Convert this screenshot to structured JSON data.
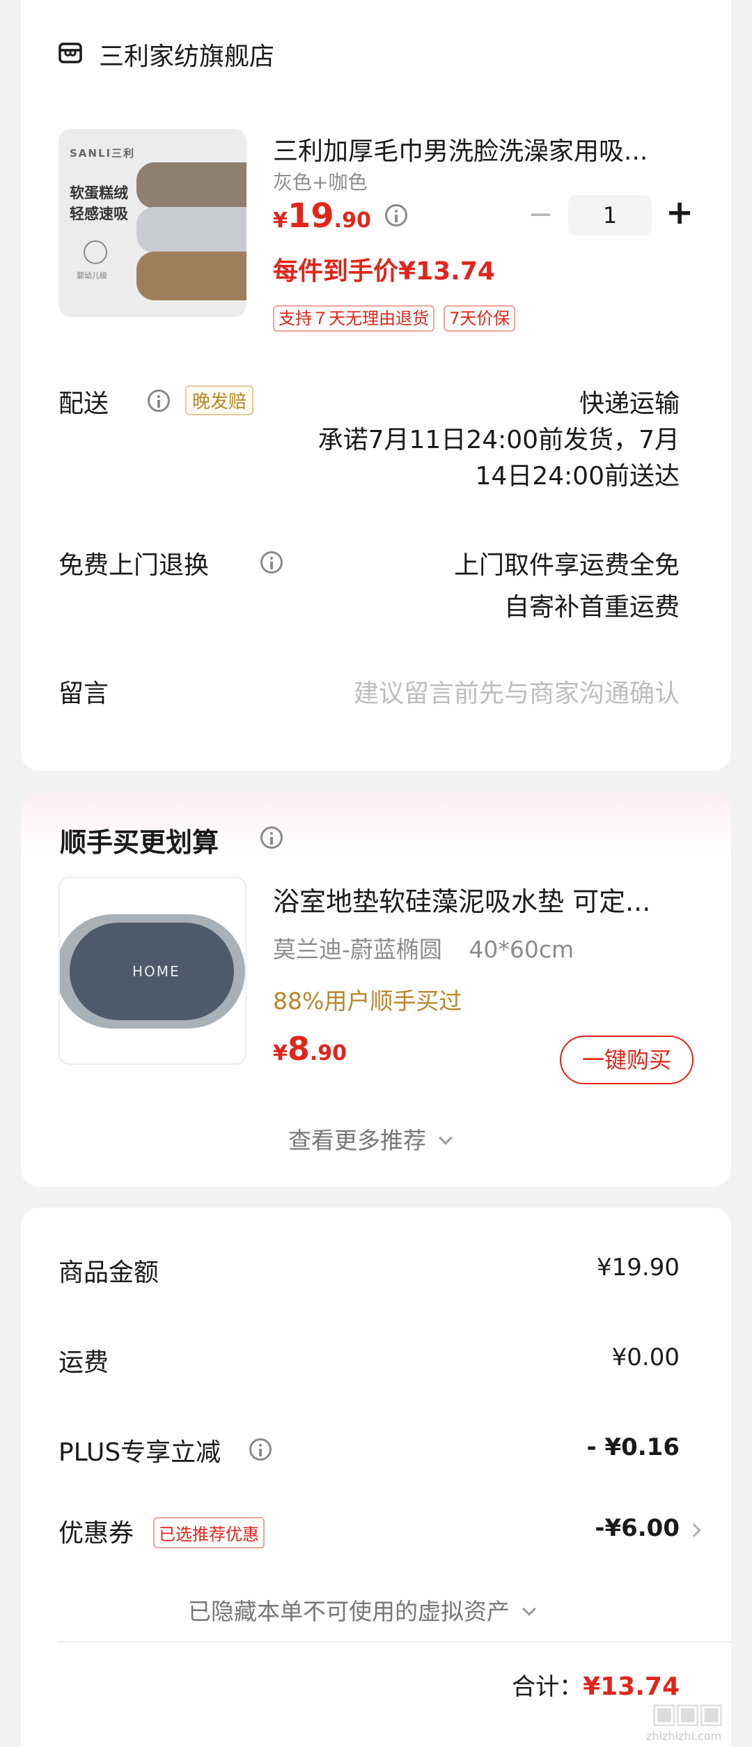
{
  "store": {
    "name": "三利家纺旗舰店"
  },
  "product": {
    "title": "三利加厚毛巾男洗脸洗澡家用吸...",
    "variant": "灰色+咖色",
    "image_brand": "SANLI三利",
    "image_text_line1": "软蛋糕绒",
    "image_text_line2": "轻感速吸",
    "image_badge": "婴幼儿级",
    "price_symbol": "¥",
    "price_int": "19",
    "price_dec": ".90",
    "quantity": "1",
    "minus": "−",
    "plus": "+",
    "per_item_price": "每件到手价¥13.74",
    "tags": [
      "支持７天无理由退货",
      "7天价保"
    ]
  },
  "delivery": {
    "label": "配送",
    "badge": "晚发赔",
    "method": "快递运输",
    "promise_line1": "承诺7月11日24:00前发货，7月",
    "promise_line2": "14日24:00前送达"
  },
  "returns": {
    "label": "免费上门退换",
    "line1": "上门取件享运费全免",
    "line2": "自寄补首重运费"
  },
  "message": {
    "label": "留言",
    "placeholder": "建议留言前先与商家沟通确认"
  },
  "recommend": {
    "section_title": "顺手买更划算",
    "title": "浴室地垫软硅藻泥吸水垫 可定...",
    "variant": "莫兰迪-蔚蓝椭圆",
    "size": "40*60cm",
    "social_proof": "88%用户顺手买过",
    "image_text": "HOME",
    "price_symbol": "¥",
    "price_int": "8",
    "price_dec": ".90",
    "buy_button": "一键购买",
    "more": "查看更多推荐"
  },
  "summary": {
    "goods_label": "商品金额",
    "goods_value": "¥19.90",
    "shipping_label": "运费",
    "shipping_value": "¥0.00",
    "plus_label": "PLUS专享立减",
    "plus_value": "- ¥0.16",
    "coupon_label": "优惠券",
    "coupon_tag": "已选推荐优惠",
    "coupon_value": "-¥6.00",
    "hidden_assets": "已隐藏本单不可使用的虚拟资产",
    "total_label": "合计：",
    "total_value": "¥13.74"
  },
  "watermark": {
    "text": "zhizhizhi.com"
  },
  "colors": {
    "accent_red": "#e1251b",
    "gold": "#b8862b",
    "background": "#f2f2f2"
  },
  "icons": [
    "store-icon",
    "info-icon",
    "chevron-down-icon",
    "chevron-right-icon"
  ]
}
